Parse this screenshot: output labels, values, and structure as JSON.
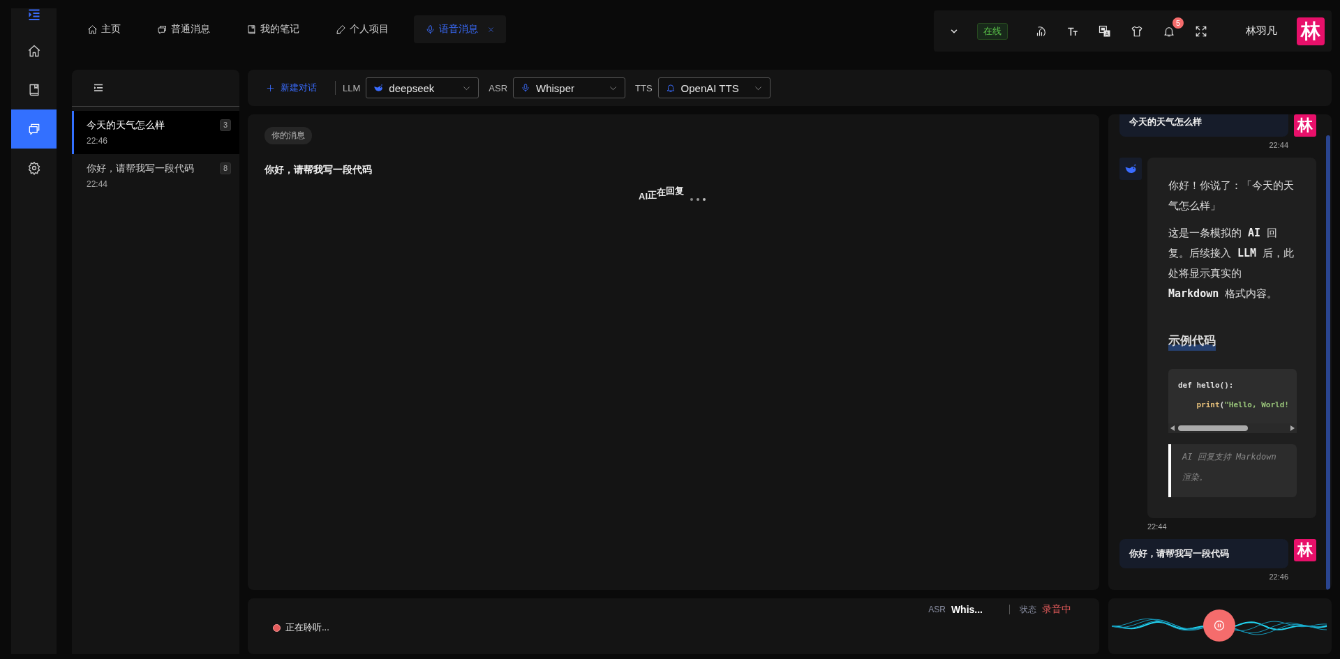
{
  "rail": {
    "items": [
      {
        "kind": "home",
        "selected": false
      },
      {
        "kind": "book",
        "selected": false
      },
      {
        "kind": "chat",
        "selected": true
      },
      {
        "kind": "gear",
        "selected": false
      }
    ]
  },
  "tabs": [
    {
      "label": "主页",
      "kind": "home",
      "selected": false,
      "closable": false
    },
    {
      "label": "普通消息",
      "kind": "chat",
      "selected": false,
      "closable": false
    },
    {
      "label": "我的笔记",
      "kind": "book",
      "selected": false,
      "closable": false
    },
    {
      "label": "个人项目",
      "kind": "pen",
      "selected": false,
      "closable": false
    },
    {
      "label": "语音消息",
      "kind": "mic",
      "selected": true,
      "closable": true
    }
  ],
  "header": {
    "status": "在线",
    "notifications": "5",
    "user_name": "林羽凡",
    "avatar": "林"
  },
  "conversations": [
    {
      "title": "今天的天气怎么样",
      "time": "22:46",
      "count": "3",
      "selected": true
    },
    {
      "title": "你好，请帮我写一段代码",
      "time": "22:44",
      "count": "8",
      "selected": false
    }
  ],
  "toolbar": {
    "new_chat": "新建对话",
    "selectors": [
      {
        "label": "LLM",
        "value": "deepseek",
        "kind": "whale"
      },
      {
        "label": "ASR",
        "value": "Whisper",
        "kind": "mic"
      },
      {
        "label": "TTS",
        "value": "OpenAI TTS",
        "kind": "bell"
      }
    ]
  },
  "transcript": {
    "tag": "你的消息",
    "text": "你好，请帮我写一段代码",
    "typing": "AI正在回复"
  },
  "messages": [
    {
      "kind": "user",
      "text": "今天的天气怎么样",
      "time": "22:44",
      "avatar": "林"
    },
    {
      "kind": "ai",
      "time": "22:44",
      "blocks": [
        {
          "kind": "p",
          "text": "你好！你说了：「今天的天气怎么样」"
        },
        {
          "kind": "p",
          "text": "这是一条模拟的 **AI** 回复。后续接入 **LLM** 后，此处将显示真实的 **Markdown** 格式内容。"
        },
        {
          "kind": "h",
          "text": "示例代码"
        },
        {
          "kind": "code",
          "lines": [
            [
              {
                "kind": "plain",
                "text": "def hello():"
              }
            ],
            [
              {
                "kind": "fn",
                "text": "    print"
              },
              {
                "kind": "plain",
                "text": "("
              },
              {
                "kind": "str",
                "text": "\"Hello, World!"
              }
            ]
          ]
        },
        {
          "kind": "quote",
          "text": "AI 回复支持 Markdown 渲染。"
        }
      ]
    },
    {
      "kind": "user",
      "text": "你好，请帮我写一段代码",
      "time": "22:46",
      "avatar": "林"
    }
  ],
  "status": {
    "listening": "正在聆听...",
    "asr_label": "ASR",
    "asr_value": "Whis...",
    "state_label": "状态",
    "state_value": "录音中"
  }
}
